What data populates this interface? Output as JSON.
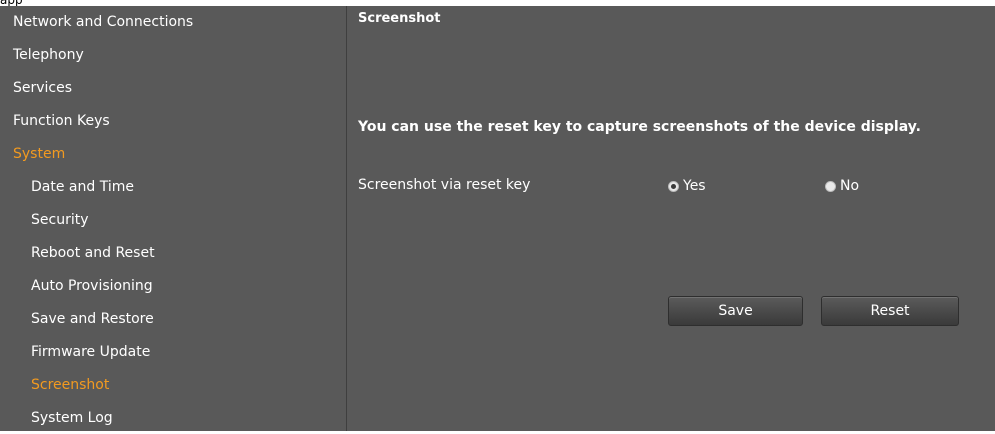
{
  "app_label": "app",
  "nav": {
    "items": [
      {
        "label": "Network and Connections",
        "level": "top",
        "active": false
      },
      {
        "label": "Telephony",
        "level": "top",
        "active": false
      },
      {
        "label": "Services",
        "level": "top",
        "active": false
      },
      {
        "label": "Function Keys",
        "level": "top",
        "active": false
      },
      {
        "label": "System",
        "level": "top",
        "active": true
      },
      {
        "label": "Date and Time",
        "level": "sub",
        "active": false
      },
      {
        "label": "Security",
        "level": "sub",
        "active": false
      },
      {
        "label": "Reboot and Reset",
        "level": "sub",
        "active": false
      },
      {
        "label": "Auto Provisioning",
        "level": "sub",
        "active": false
      },
      {
        "label": "Save and Restore",
        "level": "sub",
        "active": false
      },
      {
        "label": "Firmware Update",
        "level": "sub",
        "active": false
      },
      {
        "label": "Screenshot",
        "level": "sub",
        "active": true
      },
      {
        "label": "System Log",
        "level": "sub",
        "active": false
      }
    ]
  },
  "main": {
    "title": "Screenshot",
    "intro": "You can use the reset key to capture screenshots of the device display.",
    "field": {
      "label": "Screenshot via reset key",
      "options": [
        {
          "label": "Yes",
          "selected": true
        },
        {
          "label": "No",
          "selected": false
        }
      ]
    },
    "buttons": {
      "save": "Save",
      "reset": "Reset"
    }
  },
  "colors": {
    "background": "#595959",
    "active_text": "#f29a20",
    "text": "#ffffff"
  }
}
